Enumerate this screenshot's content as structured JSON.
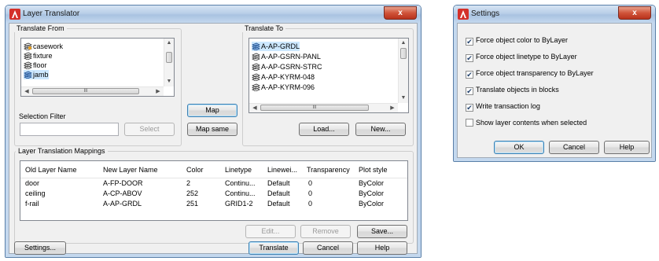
{
  "translator": {
    "title": "Layer Translator",
    "close_glyph": "x",
    "translate_from": {
      "label": "Translate From",
      "items": [
        "casework",
        "fixture",
        "floor",
        "jamb"
      ],
      "scroll_mid": "III"
    },
    "translate_to": {
      "label": "Translate To",
      "items": [
        "A-AP-GRDL",
        "A-AP-GSRN-PANL",
        "A-AP-GSRN-STRC",
        "A-AP-KYRM-048",
        "A-AP-KYRM-096"
      ],
      "scroll_mid": "III"
    },
    "selection_filter": {
      "label": "Selection Filter",
      "value": "",
      "select_label": "Select"
    },
    "map_label": "Map",
    "map_same_label": "Map same",
    "load_label": "Load...",
    "new_label": "New...",
    "mappings": {
      "label": "Layer Translation Mappings",
      "columns": [
        "Old Layer Name",
        "New Layer Name",
        "Color",
        "Linetype",
        "Linewei...",
        "Transparency",
        "Plot style"
      ],
      "rows": [
        [
          "door",
          "A-FP-DOOR",
          "2",
          "Continu...",
          "Default",
          "0",
          "ByColor"
        ],
        [
          "ceiling",
          "A-CP-ABOV",
          "252",
          "Continu...",
          "Default",
          "0",
          "ByColor"
        ],
        [
          "f-rail",
          "A-AP-GRDL",
          "251",
          "GRID1-2",
          "Default",
          "0",
          "ByColor"
        ]
      ]
    },
    "edit_label": "Edit...",
    "remove_label": "Remove",
    "save_label": "Save...",
    "settings_label": "Settings...",
    "translate_label": "Translate",
    "cancel_label": "Cancel",
    "help_label": "Help"
  },
  "settings": {
    "title": "Settings",
    "close_glyph": "x",
    "options": [
      {
        "label": "Force object color to ByLayer",
        "checked": true
      },
      {
        "label": "Force object linetype to ByLayer",
        "checked": true
      },
      {
        "label": "Force object transparency to ByLayer",
        "checked": true
      },
      {
        "label": "Translate objects in blocks",
        "checked": true
      },
      {
        "label": "Write transaction log",
        "checked": true
      },
      {
        "label": "Show layer contents when selected",
        "checked": false
      }
    ],
    "ok_label": "OK",
    "cancel_label": "Cancel",
    "help_label": "Help"
  },
  "colors": {
    "accent": "#3c7fb1",
    "close_red": "#c8402a",
    "selection": "#cde8ff",
    "icon_red": "#d4302a"
  }
}
